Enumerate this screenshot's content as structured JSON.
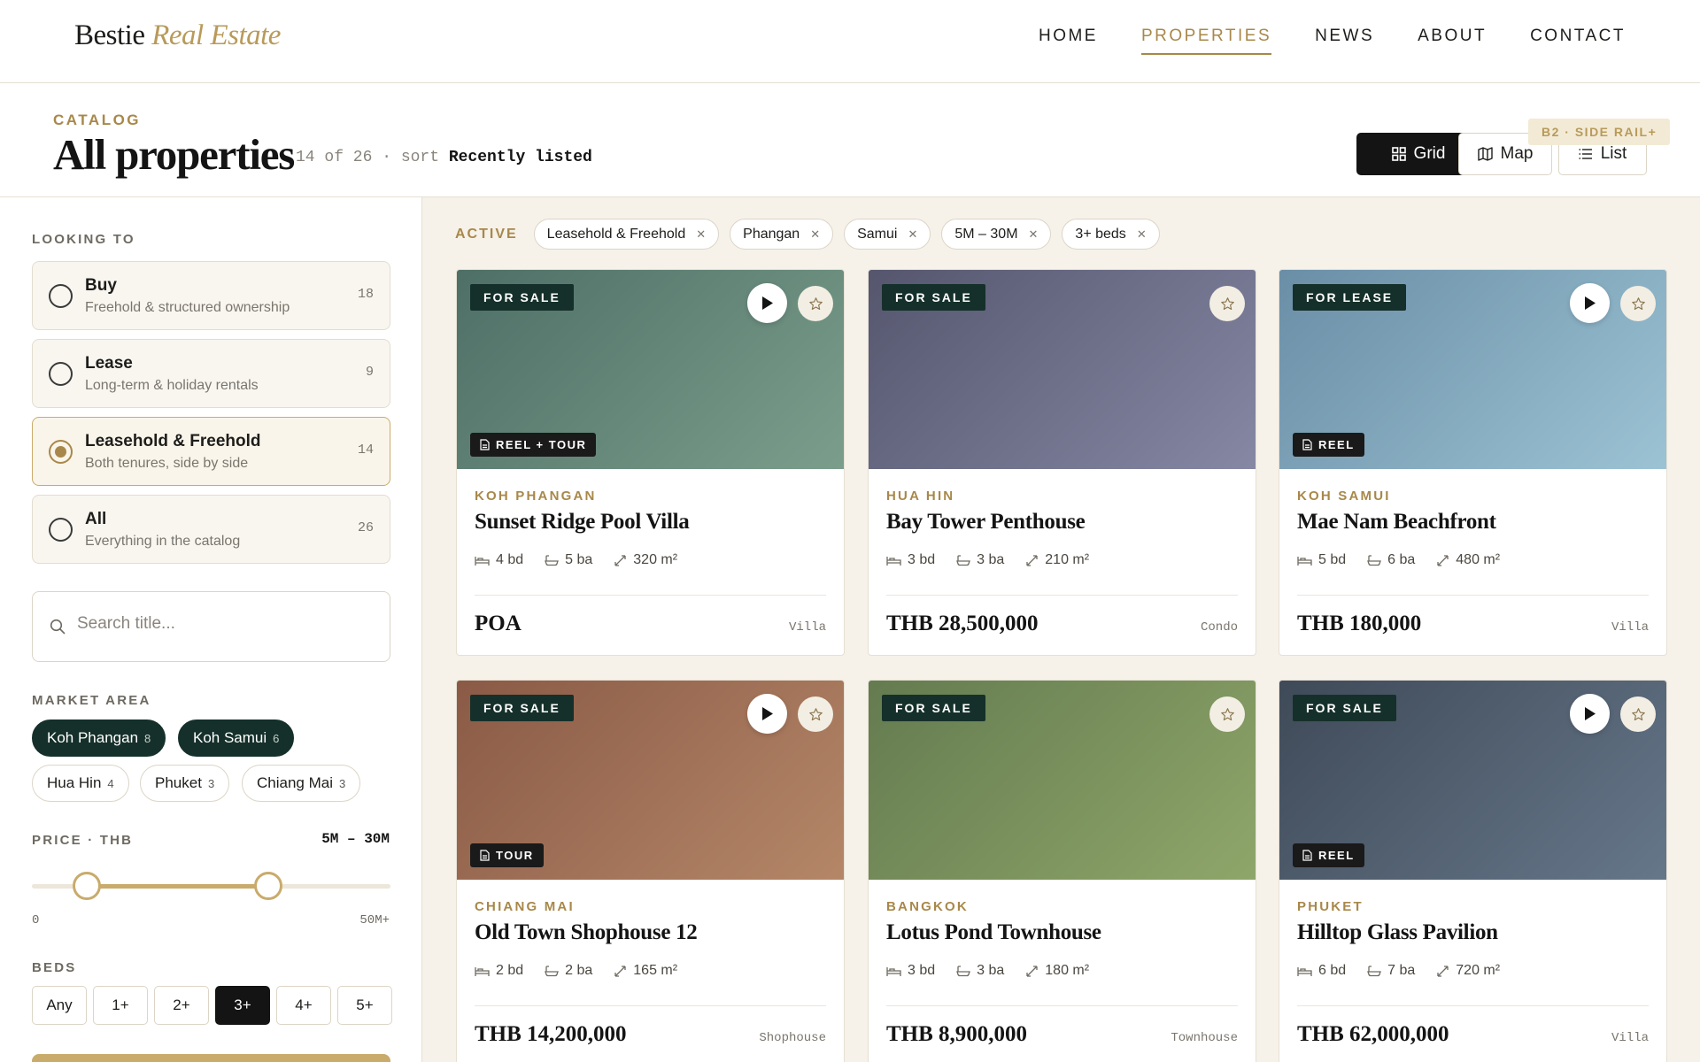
{
  "header": {
    "logo_main": "Bestie",
    "logo_accent": "Real Estate",
    "nav": [
      "HOME",
      "PROPERTIES",
      "NEWS",
      "ABOUT",
      "CONTACT"
    ],
    "active_nav": "PROPERTIES"
  },
  "titlebar": {
    "eyebrow": "CATALOG",
    "title": "All properties",
    "count_text": "14 of 26 · sort ",
    "sort_value": "Recently listed",
    "views": [
      "Grid",
      "Map",
      "List"
    ],
    "active_view": "Grid",
    "badge": "B2 · SIDE RAIL+"
  },
  "sidebar": {
    "looking_label": "LOOKING TO",
    "options": [
      {
        "title": "Buy",
        "sub": "Freehold & structured ownership",
        "count": "18",
        "selected": false
      },
      {
        "title": "Lease",
        "sub": "Long-term & holiday rentals",
        "count": "9",
        "selected": false
      },
      {
        "title": "Leasehold & Freehold",
        "sub": "Both tenures, side by side",
        "count": "14",
        "selected": true
      },
      {
        "title": "All",
        "sub": "Everything in the catalog",
        "count": "26",
        "selected": false
      }
    ],
    "search_placeholder": "Search title...",
    "market_label": "MARKET AREA",
    "markets": [
      {
        "name": "Koh Phangan",
        "count": "8",
        "active": true
      },
      {
        "name": "Koh Samui",
        "count": "6",
        "active": true
      },
      {
        "name": "Hua Hin",
        "count": "4",
        "active": false
      },
      {
        "name": "Phuket",
        "count": "3",
        "active": false
      },
      {
        "name": "Chiang Mai",
        "count": "3",
        "active": false
      }
    ],
    "price_label": "PRICE · THB",
    "price_range": "5M – 30M",
    "price_min_label": "0",
    "price_max_label": "50M+",
    "price_low": 5,
    "price_high": 30,
    "price_max": 50,
    "beds_label": "BEDS",
    "beds": [
      "Any",
      "1+",
      "2+",
      "3+",
      "4+",
      "5+"
    ],
    "beds_active": "3+"
  },
  "filters": {
    "label": "ACTIVE",
    "chips": [
      "Leasehold & Freehold",
      "Phangan",
      "Samui",
      "5M – 30M",
      "3+ beds"
    ]
  },
  "listings": [
    {
      "status": "FOR SALE",
      "media": "REEL + TOUR",
      "play": true,
      "location": "KOH PHANGAN",
      "name": "Sunset Ridge Pool Villa",
      "beds": "4 bd",
      "baths": "5 ba",
      "area": "320 m²",
      "price": "POA",
      "type": "Villa",
      "gradient": [
        "#4e6f66",
        "#7b9e8c"
      ]
    },
    {
      "status": "FOR SALE",
      "media": "",
      "play": false,
      "location": "HUA HIN",
      "name": "Bay Tower Penthouse",
      "beds": "3 bd",
      "baths": "3 ba",
      "area": "210 m²",
      "price": "THB 28,500,000",
      "type": "Condo",
      "gradient": [
        "#55566e",
        "#8688a4"
      ]
    },
    {
      "status": "FOR LEASE",
      "media": "REEL",
      "play": true,
      "location": "KOH SAMUI",
      "name": "Mae Nam Beachfront",
      "beds": "5 bd",
      "baths": "6 ba",
      "area": "480 m²",
      "price": "THB 180,000",
      "type": "Villa",
      "gradient": [
        "#6a8ea6",
        "#9cc3d4"
      ]
    },
    {
      "status": "FOR SALE",
      "media": "TOUR",
      "play": true,
      "location": "CHIANG MAI",
      "name": "Old Town Shophouse 12",
      "beds": "2 bd",
      "baths": "2 ba",
      "area": "165 m²",
      "price": "THB 14,200,000",
      "type": "Shophouse",
      "gradient": [
        "#8a5a46",
        "#b58768"
      ]
    },
    {
      "status": "FOR SALE",
      "media": "",
      "play": false,
      "location": "BANGKOK",
      "name": "Lotus Pond Townhouse",
      "beds": "3 bd",
      "baths": "3 ba",
      "area": "180 m²",
      "price": "THB 8,900,000",
      "type": "Townhouse",
      "gradient": [
        "#647b50",
        "#8fa66a"
      ]
    },
    {
      "status": "FOR SALE",
      "media": "REEL",
      "play": true,
      "location": "PHUKET",
      "name": "Hilltop Glass Pavilion",
      "beds": "6 bd",
      "baths": "7 ba",
      "area": "720 m²",
      "price": "THB 62,000,000",
      "type": "Villa",
      "gradient": [
        "#3f4a58",
        "#66778a"
      ]
    }
  ],
  "colors": {
    "accent": "#a8884a",
    "dark_green": "#15302a",
    "ink": "#141414"
  }
}
